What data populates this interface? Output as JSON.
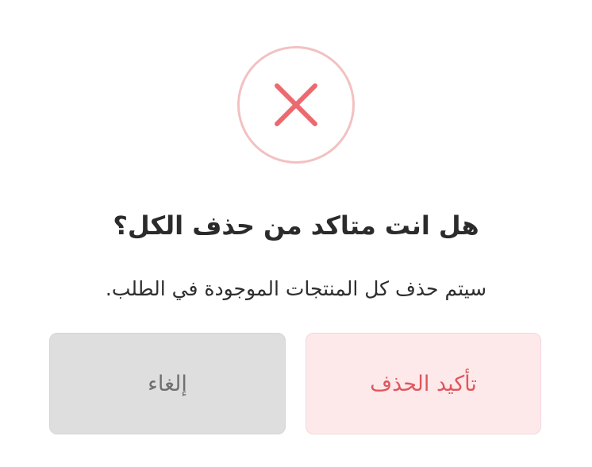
{
  "dialog": {
    "icon": "close-x-icon",
    "title": "هل انت متاكد من حذف الكل؟",
    "message": "سيتم حذف كل المنتجات الموجودة في الطلب.",
    "confirm_label": "تأكيد الحذف",
    "cancel_label": "إلغاء"
  },
  "colors": {
    "danger": "#e0565e",
    "danger_light": "#fde9ea",
    "icon_ring": "#f3c1c1",
    "cancel_bg": "#dedede",
    "cancel_text": "#6f6f6f",
    "title_text": "#2b2b2b"
  }
}
